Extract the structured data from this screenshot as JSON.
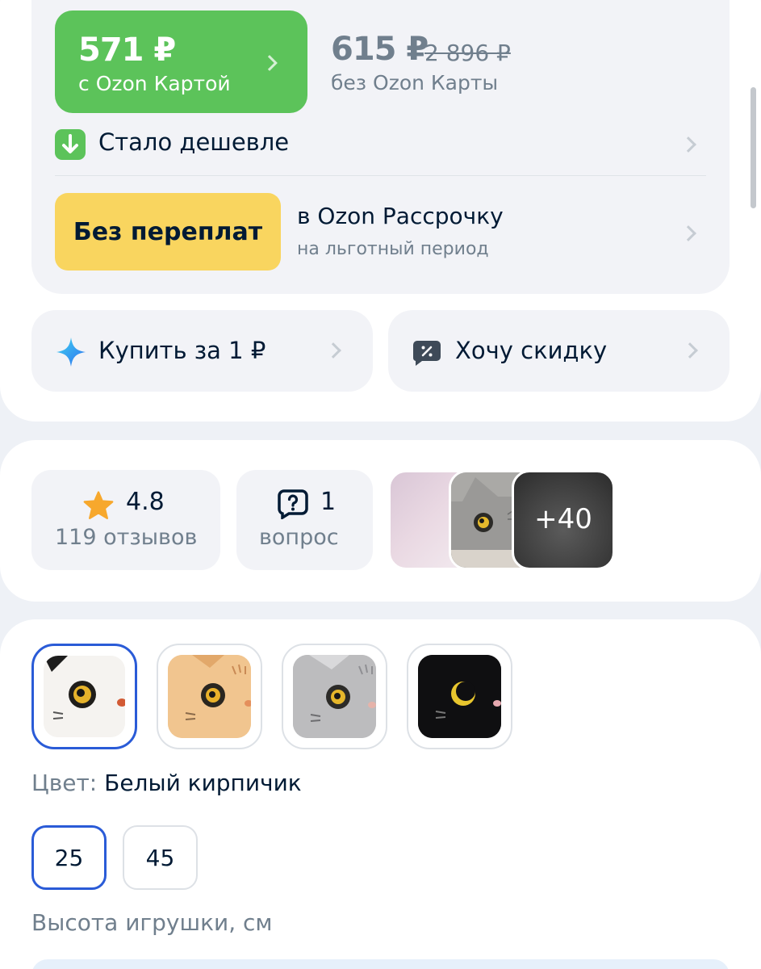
{
  "price": {
    "ozon_card_price": "571 ₽",
    "ozon_card_caption": "с Ozon Картой",
    "regular_price": "615 ₽",
    "old_price": "2 896 ₽",
    "regular_caption": "без Ozon Карты",
    "cheaper_label": "Стало дешевле"
  },
  "installment": {
    "badge": "Без переплат",
    "title": "в Ozon Рассрочку",
    "subtitle": "на льготный период"
  },
  "actions": {
    "buy_for_1_label": "Купить за 1 ₽",
    "want_discount_label": "Хочу скидку"
  },
  "reviews": {
    "rating": "4.8",
    "reviews_count": "119 отзывов",
    "questions_count": "1",
    "questions_label": "вопрос",
    "photos_more": "+40"
  },
  "variant": {
    "color_key": "Цвет:",
    "color_value": "Белый кирпичик",
    "swatches": [
      "white",
      "orange",
      "gray",
      "black"
    ],
    "sizes": [
      "25",
      "45"
    ],
    "selected_size": "25",
    "size_caption": "Высота игрушки, см"
  },
  "colors": {
    "ozon_green": "#5cc35a",
    "installment_yellow": "#f9d55f",
    "selected_blue": "#2a5bd7",
    "muted_text": "#707f8d"
  }
}
